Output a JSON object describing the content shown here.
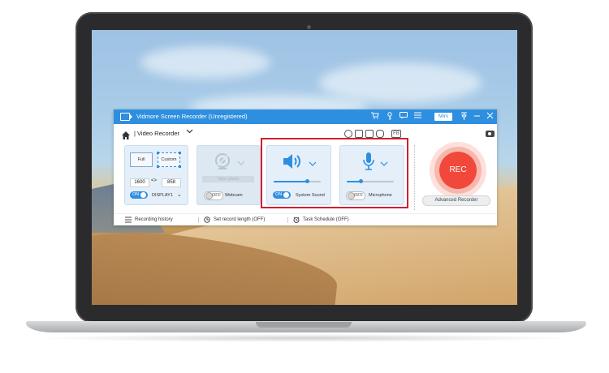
{
  "window": {
    "title": "Vidmore Screen Recorder (Unregistered)",
    "mini_label": "Mini"
  },
  "toolbar": {
    "mode_label": "| Video Recorder",
    "fb_label": "FB"
  },
  "display_panel": {
    "full_label": "Full",
    "custom_label": "Custom",
    "width": "1600",
    "height": "858",
    "toggle": "ON",
    "display_select": "DISPLAY1"
  },
  "webcam_panel": {
    "take_photo_label": "Take photo",
    "toggle": "OFF",
    "label": "Webcam"
  },
  "system_sound_panel": {
    "toggle": "ON",
    "label": "System Sound",
    "volume": 0.72
  },
  "microphone_panel": {
    "toggle": "OFF",
    "label": "Microphone",
    "volume": 0.3
  },
  "rec_button": {
    "label": "REC"
  },
  "advanced_recorder_label": "Advanced Recorder",
  "bottom_bar": {
    "history": "Recording history",
    "record_length": "Set record length (OFF)",
    "task_schedule": "Task Schedule (OFF)"
  },
  "colors": {
    "accent": "#2e8fe0",
    "rec": "#f2483b",
    "highlight": "#d02030"
  }
}
